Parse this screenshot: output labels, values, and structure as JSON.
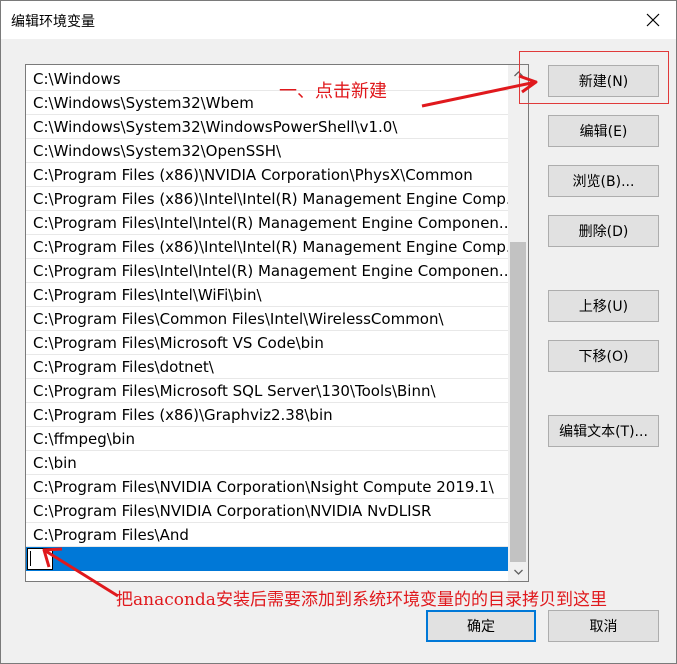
{
  "window": {
    "title": "编辑环境变量"
  },
  "path_list": [
    "C:\\Windows",
    "C:\\Windows\\System32\\Wbem",
    "C:\\Windows\\System32\\WindowsPowerShell\\v1.0\\",
    "C:\\Windows\\System32\\OpenSSH\\",
    "C:\\Program Files (x86)\\NVIDIA Corporation\\PhysX\\Common",
    "C:\\Program Files (x86)\\Intel\\Intel(R) Management Engine Comp...",
    "C:\\Program Files\\Intel\\Intel(R) Management Engine Componen...",
    "C:\\Program Files (x86)\\Intel\\Intel(R) Management Engine Comp...",
    "C:\\Program Files\\Intel\\Intel(R) Management Engine Componen...",
    "C:\\Program Files\\Intel\\WiFi\\bin\\",
    "C:\\Program Files\\Common Files\\Intel\\WirelessCommon\\",
    "C:\\Program Files\\Microsoft VS Code\\bin",
    "C:\\Program Files\\dotnet\\",
    "C:\\Program Files\\Microsoft SQL Server\\130\\Tools\\Binn\\",
    "C:\\Program Files (x86)\\Graphviz2.38\\bin",
    "C:\\ffmpeg\\bin",
    "C:\\bin",
    "C:\\Program Files\\NVIDIA Corporation\\Nsight Compute 2019.1\\",
    "C:\\Program Files\\NVIDIA Corporation\\NVIDIA NvDLISR",
    "C:\\Program Files\\And"
  ],
  "new_entry_value": "",
  "buttons": {
    "new": "新建(N)",
    "edit": "编辑(E)",
    "browse": "浏览(B)...",
    "delete": "删除(D)",
    "move_up": "上移(U)",
    "move_down": "下移(O)",
    "edit_text": "编辑文本(T)...",
    "ok": "确定",
    "cancel": "取消"
  },
  "annotations": {
    "step_new": "一、点击新建",
    "step_paste": "把anaconda安装后需要添加到系统环境变量的的目录拷贝到这里",
    "color": "#e0191d"
  },
  "colors": {
    "selection": "#0078d7",
    "annotation": "#e0191d"
  }
}
